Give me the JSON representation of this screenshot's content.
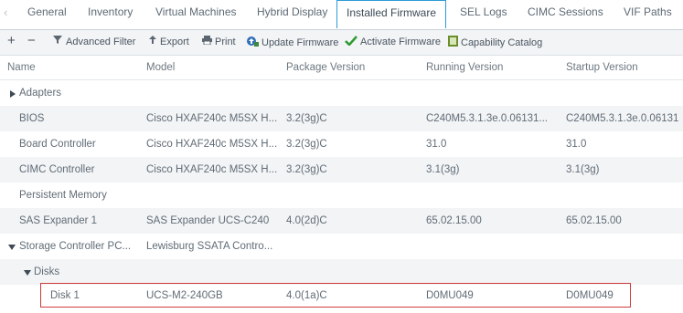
{
  "tabs": [
    {
      "label": "General"
    },
    {
      "label": "Inventory"
    },
    {
      "label": "Virtual Machines"
    },
    {
      "label": "Hybrid Display"
    },
    {
      "label": "Installed Firmware"
    },
    {
      "label": "SEL Logs"
    },
    {
      "label": "CIMC Sessions"
    },
    {
      "label": "VIF Paths"
    }
  ],
  "active_tab": "Installed Firmware",
  "toolbar": {
    "add": "+",
    "remove": "−",
    "advanced_filter": "Advanced Filter",
    "export": "Export",
    "print": "Print",
    "update_firmware": "Update Firmware",
    "activate_firmware": "Activate Firmware",
    "capability_catalog": "Capability Catalog"
  },
  "columns": [
    "Name",
    "Model",
    "Package Version",
    "Running Version",
    "Startup Version"
  ],
  "rows": [
    {
      "name": "Adapters",
      "model": "",
      "package": "",
      "running": "",
      "startup": ""
    },
    {
      "name": "BIOS",
      "model": "Cisco HXAF240c M5SX H...",
      "package": "3.2(3g)C",
      "running": "C240M5.3.1.3e.0.06131...",
      "startup": "C240M5.3.1.3e.0.06131"
    },
    {
      "name": "Board Controller",
      "model": "Cisco HXAF240c M5SX H...",
      "package": "3.2(3g)C",
      "running": "31.0",
      "startup": "31.0"
    },
    {
      "name": "CIMC Controller",
      "model": "Cisco HXAF240c M5SX H...",
      "package": "3.2(3g)C",
      "running": "3.1(3g)",
      "startup": "3.1(3g)"
    },
    {
      "name": "Persistent Memory",
      "model": "",
      "package": "",
      "running": "",
      "startup": ""
    },
    {
      "name": "SAS Expander 1",
      "model": "SAS Expander UCS-C240",
      "package": "4.0(2d)C",
      "running": "65.02.15.00",
      "startup": "65.02.15.00"
    },
    {
      "name": "Storage Controller PC...",
      "model": "Lewisburg SSATA Contro...",
      "package": "",
      "running": "",
      "startup": ""
    },
    {
      "name": "Disks",
      "model": "",
      "package": "",
      "running": "",
      "startup": ""
    },
    {
      "name": "Disk 1",
      "model": "UCS-M2-240GB",
      "package": "4.0(1a)C",
      "running": "D0MU049",
      "startup": "D0MU049"
    }
  ],
  "colors": {
    "accent": "#2d9bd6",
    "highlight": "#cf3b3b",
    "shaded_row": "#f2f4f6"
  }
}
